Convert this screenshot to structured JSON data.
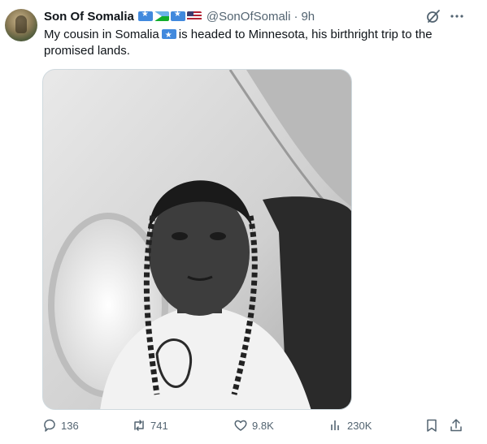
{
  "author": {
    "display_name": "Son Of Somalia",
    "handle": "@SonOfSomali",
    "separator": "·",
    "time": "9h",
    "flags": [
      "flag-somalia",
      "flag-djibouti",
      "flag-somalia",
      "flag-usa"
    ]
  },
  "tweet": {
    "text_before_flag": "My cousin in Somalia",
    "text_after_flag": "is headed to Minnesota, his birthright trip to the promised lands."
  },
  "actions": {
    "replies": "136",
    "reposts": "741",
    "likes": "9.8K",
    "views": "230K"
  },
  "icons": {
    "grok": "grok-icon",
    "more": "more-dots-icon",
    "reply": "reply-icon",
    "repost": "repost-icon",
    "like": "heart-icon",
    "views": "bar-chart-icon",
    "bookmark": "bookmark-icon",
    "share": "share-icon"
  },
  "colors": {
    "text": "#0f1419",
    "secondary": "#536471",
    "border": "#cfd9de"
  }
}
